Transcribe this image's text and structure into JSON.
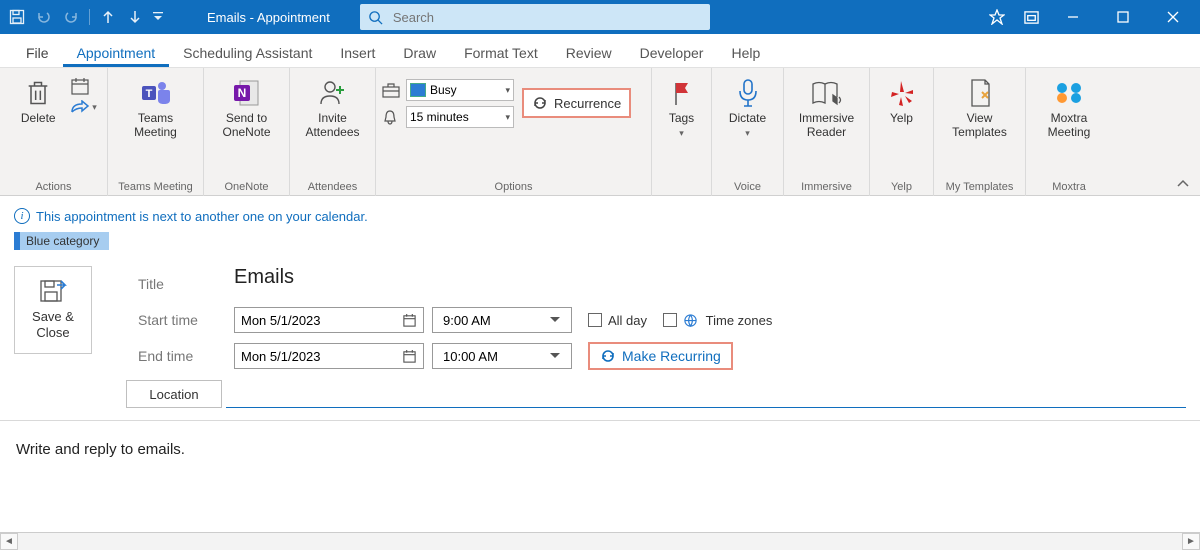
{
  "titlebar": {
    "title": "Emails  -  Appointment",
    "search_placeholder": "Search"
  },
  "tabs": {
    "file": "File",
    "appointment": "Appointment",
    "scheduling": "Scheduling Assistant",
    "insert": "Insert",
    "draw": "Draw",
    "format": "Format Text",
    "review": "Review",
    "developer": "Developer",
    "help": "Help"
  },
  "ribbon": {
    "actions": {
      "delete": "Delete",
      "group": "Actions"
    },
    "teams": {
      "btn": "Teams\nMeeting",
      "group": "Teams Meeting"
    },
    "onenote": {
      "btn": "Send to\nOneNote",
      "group": "OneNote"
    },
    "attendees": {
      "btn": "Invite\nAttendees",
      "group": "Attendees"
    },
    "options": {
      "show_as": "Busy",
      "reminder": "15 minutes",
      "recurrence": "Recurrence",
      "group": "Options"
    },
    "tags": {
      "btn": "Tags",
      "group": ""
    },
    "dictate": {
      "btn": "Dictate",
      "group": "Voice"
    },
    "immersive": {
      "btn": "Immersive\nReader",
      "group": "Immersive"
    },
    "yelp": {
      "btn": "Yelp",
      "group": "Yelp"
    },
    "templates": {
      "btn": "View\nTemplates",
      "group": "My Templates"
    },
    "moxtra": {
      "btn": "Moxtra\nMeeting",
      "group": "Moxtra"
    }
  },
  "infobar": {
    "text": "This appointment is next to another one on your calendar."
  },
  "category": {
    "label": "Blue category"
  },
  "form": {
    "save": "Save &\nClose",
    "title_label": "Title",
    "start_label": "Start time",
    "end_label": "End time",
    "location_label": "Location",
    "title_value": "Emails",
    "start_date": "Mon 5/1/2023",
    "start_time": "9:00 AM",
    "end_date": "Mon 5/1/2023",
    "end_time": "10:00 AM",
    "all_day": "All day",
    "time_zones": "Time zones",
    "make_recurring": "Make Recurring"
  },
  "body": {
    "text": "Write and reply to emails."
  },
  "colors": {
    "accent": "#106ebe",
    "callout_border": "#e98c7c"
  }
}
